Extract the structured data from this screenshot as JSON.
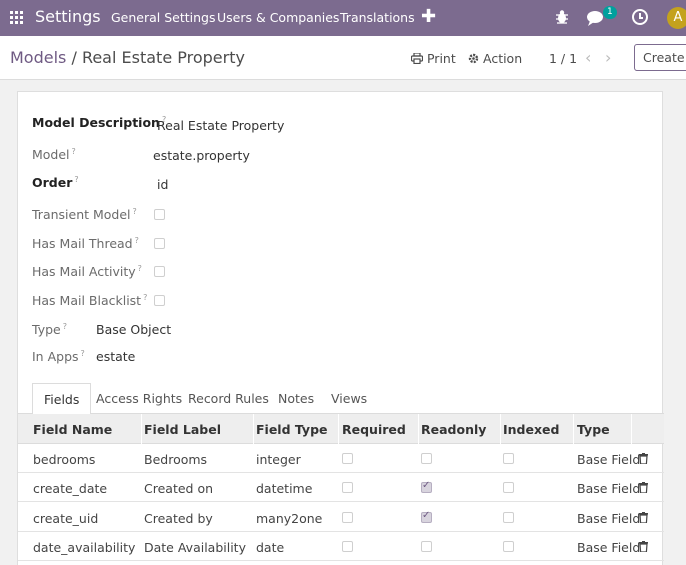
{
  "navbar": {
    "brand": "Settings",
    "menu": [
      "General Settings",
      "Users & Companies",
      "Translations"
    ],
    "plus": "✚",
    "badge": "1",
    "avatar": "A"
  },
  "control": {
    "breadcrumb_root": "Models",
    "breadcrumb_sep": " / ",
    "breadcrumb_current": "Real Estate Property",
    "print_label": "Print",
    "action_label": "Action",
    "pager": "1 / 1",
    "prev": "‹",
    "next": "›",
    "create_label": "Create"
  },
  "form": {
    "model_description_label": "Model Description",
    "model_description": "Real Estate Property",
    "model_label": "Model",
    "model": "estate.property",
    "order_label": "Order",
    "order": "id",
    "transient_label": "Transient Model",
    "mail_thread_label": "Has Mail Thread",
    "mail_activity_label": "Has Mail Activity",
    "mail_blacklist_label": "Has Mail Blacklist",
    "type_label": "Type",
    "type": "Base Object",
    "in_apps_label": "In Apps",
    "in_apps": "estate",
    "help_mark": "?"
  },
  "tabs": [
    "Fields",
    "Access Rights",
    "Record Rules",
    "Notes",
    "Views"
  ],
  "table": {
    "headers": [
      "Field Name",
      "Field Label",
      "Field Type",
      "Required",
      "Readonly",
      "Indexed",
      "Type"
    ],
    "rows": [
      {
        "name": "bedrooms",
        "label": "Bedrooms",
        "ftype": "integer",
        "required": false,
        "readonly": false,
        "indexed": false,
        "type": "Base Field"
      },
      {
        "name": "create_date",
        "label": "Created on",
        "ftype": "datetime",
        "required": false,
        "readonly": true,
        "indexed": false,
        "type": "Base Field"
      },
      {
        "name": "create_uid",
        "label": "Created by",
        "ftype": "many2one",
        "required": false,
        "readonly": true,
        "indexed": false,
        "type": "Base Field"
      },
      {
        "name": "date_availability",
        "label": "Date Availability",
        "ftype": "date",
        "required": false,
        "readonly": false,
        "indexed": false,
        "type": "Base Field"
      }
    ]
  }
}
